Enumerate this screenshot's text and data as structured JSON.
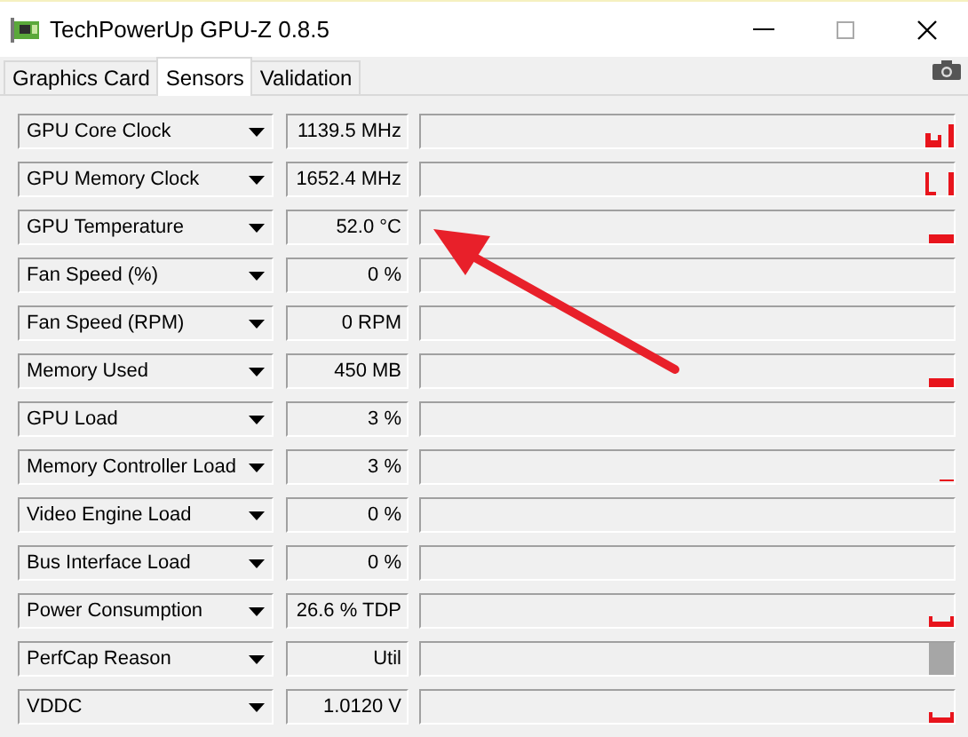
{
  "window": {
    "title": "TechPowerUp GPU-Z 0.8.5"
  },
  "tabs": [
    {
      "label": "Graphics Card",
      "selected": false
    },
    {
      "label": "Sensors",
      "selected": true
    },
    {
      "label": "Validation",
      "selected": false
    }
  ],
  "sensors": [
    {
      "name": "GPU Core Clock",
      "value": "1139.5 MHz",
      "kind": "steps"
    },
    {
      "name": "GPU Memory Clock",
      "value": "1652.4 MHz",
      "kind": "corner"
    },
    {
      "name": "GPU Temperature",
      "value": "52.0 °C",
      "kind": "thick"
    },
    {
      "name": "Fan Speed (%)",
      "value": "0 %",
      "kind": "empty"
    },
    {
      "name": "Fan Speed (RPM)",
      "value": "0 RPM",
      "kind": "empty"
    },
    {
      "name": "Memory Used",
      "value": "450 MB",
      "kind": "thick"
    },
    {
      "name": "GPU Load",
      "value": "3 %",
      "kind": "empty"
    },
    {
      "name": "Memory Controller Load",
      "value": "3 %",
      "kind": "thin"
    },
    {
      "name": "Video Engine Load",
      "value": "0 %",
      "kind": "empty"
    },
    {
      "name": "Bus Interface Load",
      "value": "0 %",
      "kind": "empty"
    },
    {
      "name": "Power Consumption",
      "value": "26.6 % TDP",
      "kind": "bracket"
    },
    {
      "name": "PerfCap Reason",
      "value": "Util",
      "kind": "block"
    },
    {
      "name": "VDDC",
      "value": "1.0120 V",
      "kind": "bracket"
    }
  ]
}
